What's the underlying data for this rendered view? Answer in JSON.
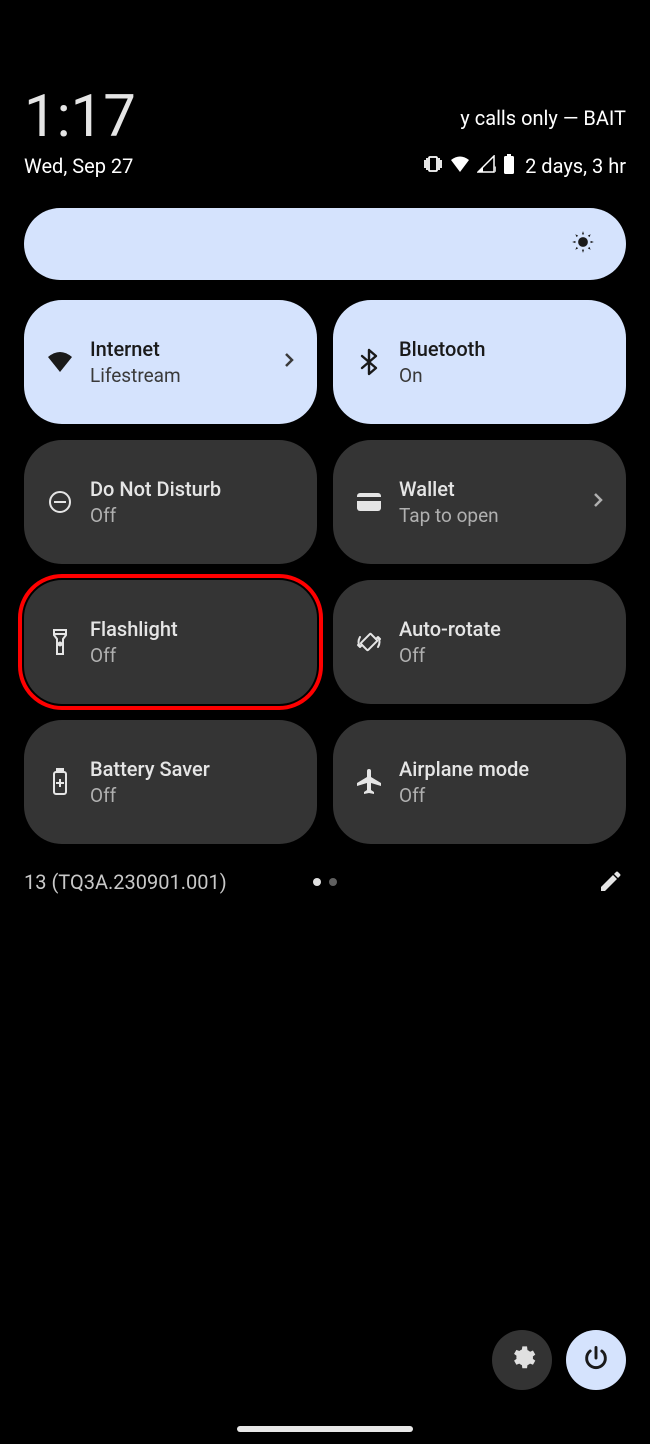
{
  "header": {
    "time": "1:17",
    "carrier": "y calls only — BAIT",
    "date": "Wed, Sep 27",
    "battery_text": "2 days, 3 hr"
  },
  "tiles": {
    "internet": {
      "label": "Internet",
      "status": "Lifestream"
    },
    "bluetooth": {
      "label": "Bluetooth",
      "status": "On"
    },
    "dnd": {
      "label": "Do Not Disturb",
      "status": "Off"
    },
    "wallet": {
      "label": "Wallet",
      "status": "Tap to open"
    },
    "flashlight": {
      "label": "Flashlight",
      "status": "Off"
    },
    "autorotate": {
      "label": "Auto-rotate",
      "status": "Off"
    },
    "batterysaver": {
      "label": "Battery Saver",
      "status": "Off"
    },
    "airplane": {
      "label": "Airplane mode",
      "status": "Off"
    }
  },
  "footer": {
    "build": "13 (TQ3A.230901.001)"
  }
}
